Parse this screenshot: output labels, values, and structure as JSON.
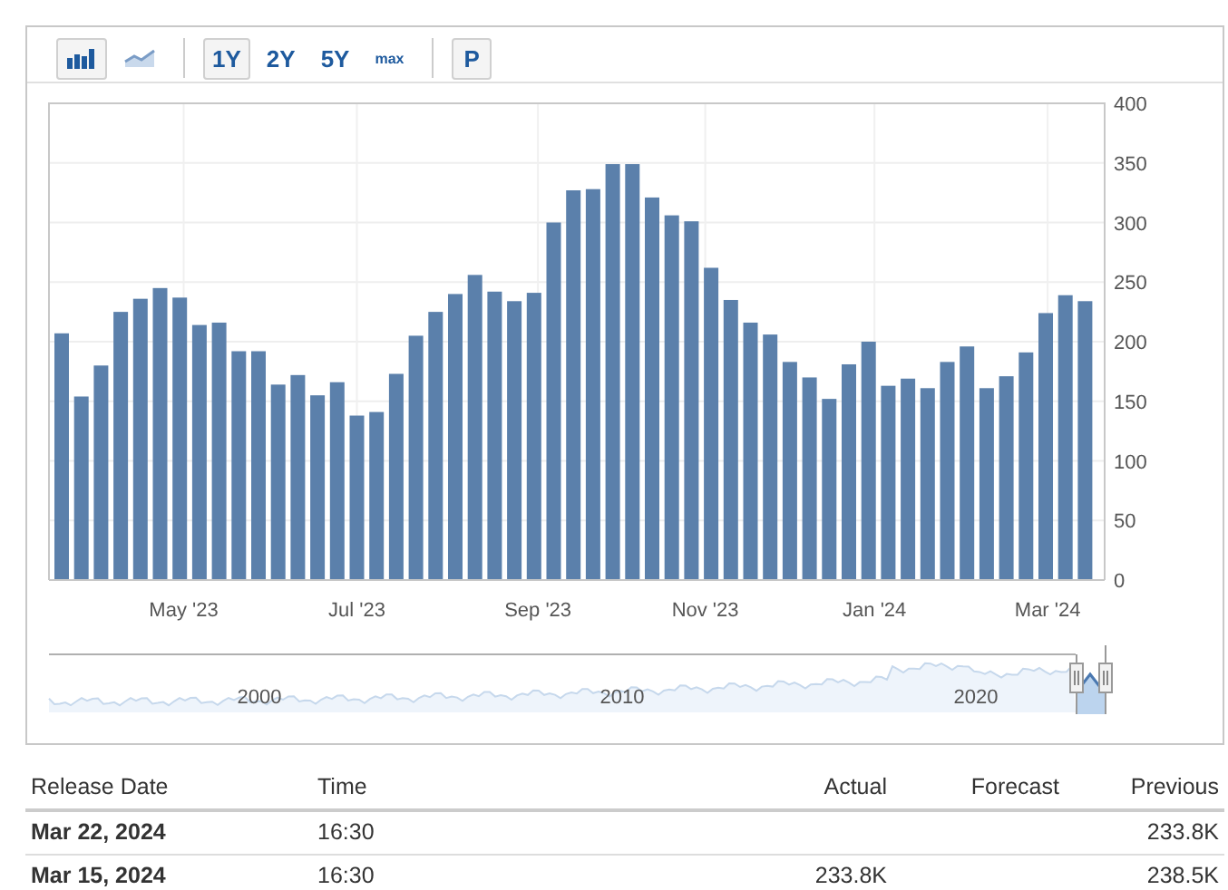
{
  "toolbar": {
    "chart_types": [
      {
        "kind": "bar",
        "selected": true
      },
      {
        "kind": "line",
        "selected": false
      }
    ],
    "ranges": [
      {
        "label": "1Y",
        "selected": true
      },
      {
        "label": "2Y",
        "selected": false
      },
      {
        "label": "5Y",
        "selected": false
      },
      {
        "label": "max",
        "selected": false
      }
    ],
    "extra_button": "P"
  },
  "chart": {
    "x_labels": [
      "May '23",
      "Jul '23",
      "Sep '23",
      "Nov '23",
      "Jan '24",
      "Mar '24"
    ],
    "chart_data": {
      "type": "bar",
      "grid": true,
      "ylim": [
        0,
        400
      ],
      "yticks": [
        0,
        50,
        100,
        150,
        200,
        250,
        300,
        350,
        400
      ],
      "series": [
        {
          "color": "#5b80ab",
          "values": [
            207,
            154,
            180,
            225,
            236,
            245,
            237,
            214,
            216,
            192,
            192,
            164,
            172,
            155,
            166,
            138,
            141,
            173,
            205,
            225,
            240,
            256,
            242,
            234,
            241,
            300,
            327,
            328,
            349,
            349,
            321,
            306,
            301,
            262,
            235,
            216,
            206,
            183,
            170,
            152,
            181,
            200,
            163,
            169,
            161,
            183,
            196,
            161,
            171,
            191,
            224,
            239,
            234
          ]
        }
      ]
    }
  },
  "navigator": {
    "labels": [
      "2000",
      "2010",
      "2020"
    ]
  },
  "table": {
    "columns": [
      "Release Date",
      "Time",
      "Actual",
      "Forecast",
      "Previous"
    ],
    "rows": [
      {
        "release_date": "Mar 22, 2024",
        "time": "16:30",
        "previous": "233.8K"
      },
      {
        "release_date": "Mar 15, 2024",
        "time": "16:30",
        "actual": "233.8K",
        "previous": "238.5K"
      }
    ]
  }
}
